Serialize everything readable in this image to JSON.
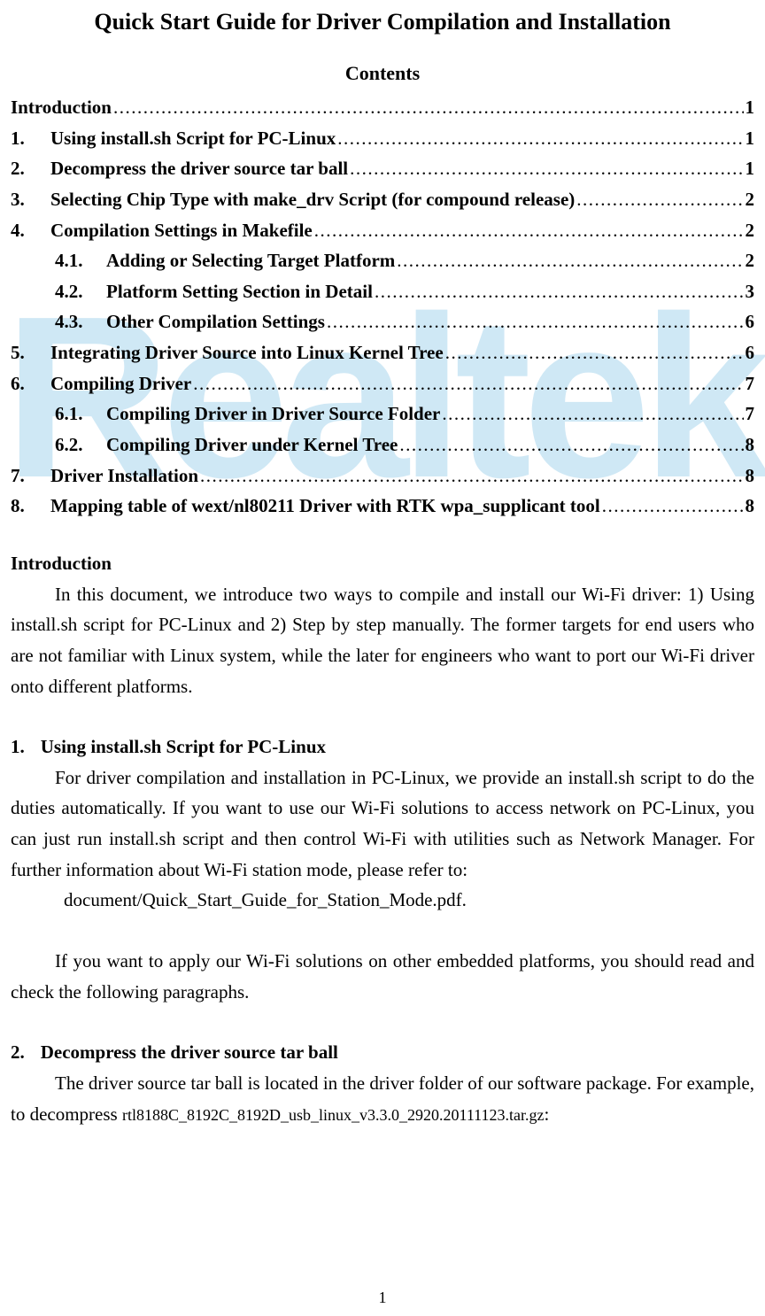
{
  "title": "Quick Start Guide for Driver Compilation and Installation",
  "contents_heading": "Contents",
  "watermark": "Realtek",
  "toc": {
    "intro": {
      "num": "",
      "label": "Introduction",
      "page": "1"
    },
    "s1": {
      "num": "1.",
      "label": "Using install.sh Script for PC-Linux",
      "page": "1"
    },
    "s2": {
      "num": "2.",
      "label": "Decompress the driver source tar ball",
      "page": "1"
    },
    "s3": {
      "num": "3.",
      "label": "Selecting Chip Type with make_drv Script (for compound release)",
      "page": "2"
    },
    "s4": {
      "num": "4.",
      "label": "Compilation Settings in Makefile",
      "page": "2"
    },
    "s4_1": {
      "num": "4.1.",
      "label": "Adding or Selecting Target Platform",
      "page": "2"
    },
    "s4_2": {
      "num": "4.2.",
      "label": "Platform Setting Section in Detail",
      "page": "3"
    },
    "s4_3": {
      "num": "4.3.",
      "label": "Other Compilation Settings",
      "page": "6"
    },
    "s5": {
      "num": "5.",
      "label": "Integrating Driver Source into Linux Kernel Tree",
      "page": "6"
    },
    "s6": {
      "num": "6.",
      "label": "Compiling Driver",
      "page": "7"
    },
    "s6_1": {
      "num": "6.1.",
      "label": "Compiling Driver in Driver Source Folder",
      "page": "7"
    },
    "s6_2": {
      "num": "6.2.",
      "label": "Compiling Driver under Kernel Tree",
      "page": "8"
    },
    "s7": {
      "num": "7.",
      "label": "Driver Installation",
      "page": "8"
    },
    "s8": {
      "num": "8.",
      "label": "Mapping table of wext/nl80211 Driver with RTK wpa_supplicant tool",
      "page": "8"
    }
  },
  "body": {
    "intro_heading": "Introduction",
    "intro_para": "In this document, we introduce two ways to compile and install our Wi-Fi driver: 1) Using install.sh script for PC-Linux and 2) Step by step manually. The former targets for end users who are not familiar with Linux system, while the later for engineers who want to port our Wi-Fi driver onto different platforms.",
    "s1_num": "1.",
    "s1_heading": "Using install.sh Script for PC-Linux",
    "s1_para1": "For driver compilation and installation in PC-Linux, we provide an install.sh script to do the duties automatically. If you want to use our Wi-Fi solutions to access network on PC-Linux, you can just run install.sh script and then control Wi-Fi with utilities such as Network Manager. For further information about Wi-Fi station mode, please refer to:",
    "s1_ref": "document/Quick_Start_Guide_for_Station_Mode.pdf.",
    "s1_para2": "If you want to apply our Wi-Fi solutions on other embedded platforms, you should read and check the following paragraphs.",
    "s2_num": "2.",
    "s2_heading": "Decompress the driver source tar ball",
    "s2_para_a": "The driver source tar ball is located in the driver folder of our software package. For example, to decompress ",
    "s2_filename": "rtl8188C_8192C_8192D_usb_linux_v3.3.0_2920.20111123.tar.gz",
    "s2_para_b": ":"
  },
  "page_number": "1"
}
